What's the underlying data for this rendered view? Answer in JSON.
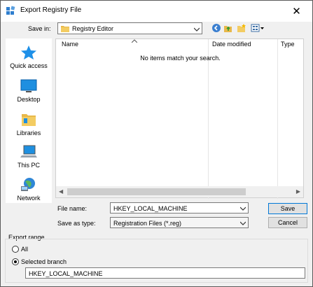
{
  "window": {
    "title": "Export Registry File"
  },
  "save_in": {
    "label": "Save in:",
    "value": "Registry Editor"
  },
  "places": [
    {
      "label": "Quick access"
    },
    {
      "label": "Desktop"
    },
    {
      "label": "Libraries"
    },
    {
      "label": "This PC"
    },
    {
      "label": "Network"
    }
  ],
  "list": {
    "columns": [
      "Name",
      "Date modified",
      "Type"
    ],
    "empty_text": "No items match your search."
  },
  "file_name": {
    "label": "File name:",
    "value": "HKEY_LOCAL_MACHINE"
  },
  "save_as_type": {
    "label": "Save as type:",
    "value": "Registration Files (*.reg)"
  },
  "buttons": {
    "save": "Save",
    "cancel": "Cancel"
  },
  "export_range": {
    "label": "Export range",
    "all_label": "All",
    "selected_label": "Selected branch",
    "branch_value": "HKEY_LOCAL_MACHINE",
    "selected": "selected_branch"
  },
  "colors": {
    "accent": "#0078d7",
    "folder": "#e8b84a",
    "scrollbar": "#cdcdcd"
  }
}
